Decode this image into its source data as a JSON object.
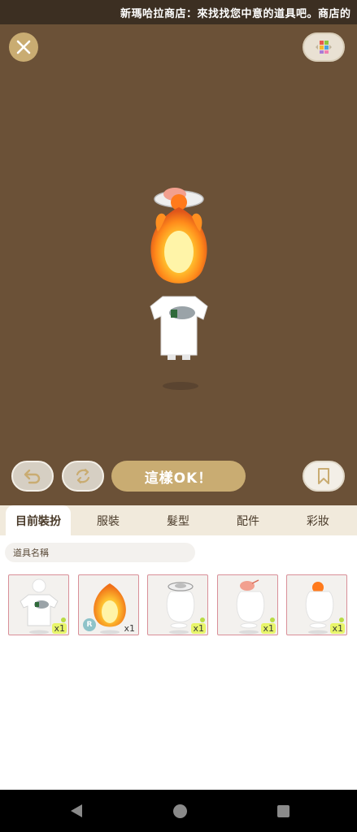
{
  "marquee": {
    "text": "新瑪哈拉商店：來找找您中意的道具吧。商店的"
  },
  "toolbar": {
    "close_icon": "close-icon",
    "palette_icon": "color-grid-icon",
    "undo_icon": "undo-icon",
    "rotate_icon": "rotate-icon",
    "ok_label": "這樣OK！",
    "bookmark_icon": "bookmark-icon"
  },
  "tabs": [
    {
      "label": "目前裝扮",
      "active": true
    },
    {
      "label": "服裝",
      "active": false
    },
    {
      "label": "髮型",
      "active": false
    },
    {
      "label": "配件",
      "active": false
    },
    {
      "label": "彩妝",
      "active": false
    }
  ],
  "search": {
    "placeholder": "道具名稱"
  },
  "items": [
    {
      "name": "white-tshirt-item",
      "qty": "x1"
    },
    {
      "name": "fire-head-item",
      "badge": "R",
      "qty": "x1"
    },
    {
      "name": "plate-hat-item",
      "qty": "x1"
    },
    {
      "name": "shrimp-hat-item",
      "qty": "x1"
    },
    {
      "name": "orange-hat-item",
      "qty": "x1"
    }
  ],
  "colors": {
    "stage_bg": "#6b5137",
    "accent_gold": "#c9ac72",
    "tab_bg": "#f1eadc",
    "item_border": "#d98f98",
    "qty_highlight": "#e8f56a"
  }
}
